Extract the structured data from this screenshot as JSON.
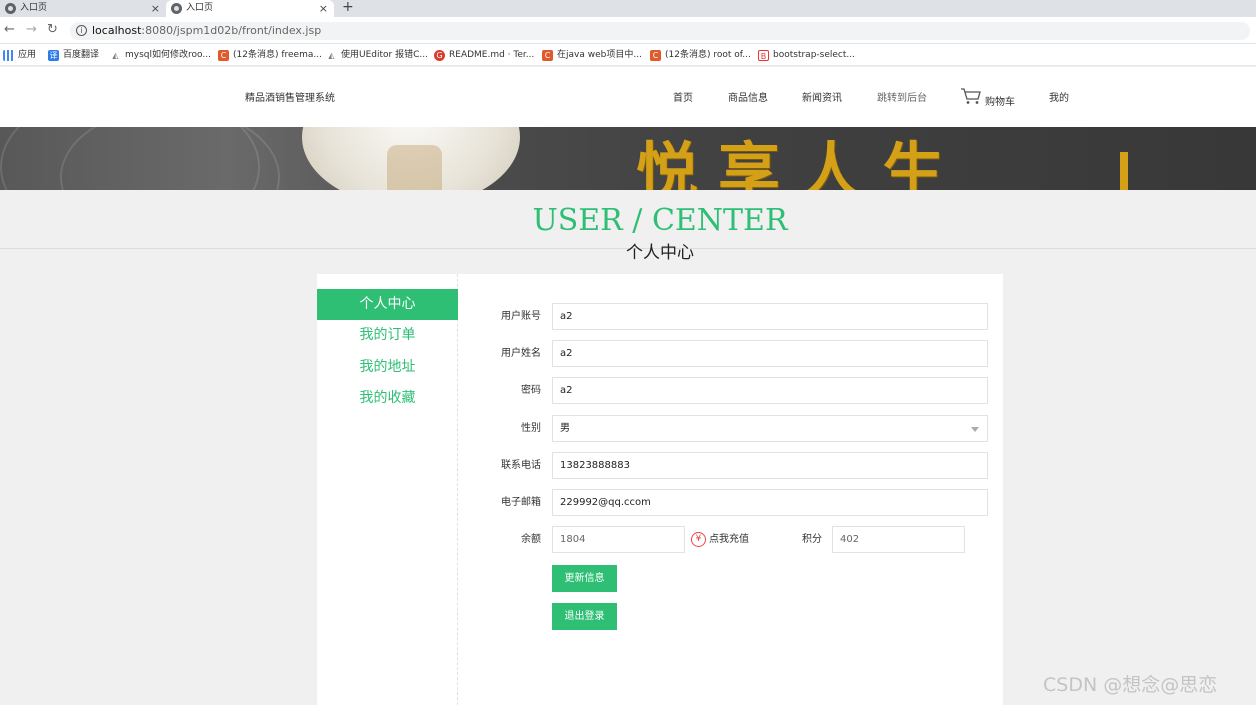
{
  "browser": {
    "tabs": [
      {
        "title": "入口页"
      },
      {
        "title": "入口页"
      }
    ],
    "new_tab": "+",
    "close_glyph": "×",
    "url_host": "localhost",
    "url_path": ":8080/jspm1d02b/front/index.jsp",
    "bookmarks": [
      {
        "label": "应用",
        "icon": "apps-grid-icon"
      },
      {
        "label": "百度翻译",
        "icon": "baidu-translate-icon"
      },
      {
        "label": "mysql如何修改roo...",
        "icon": "tool-icon"
      },
      {
        "label": "(12条消息) freema...",
        "icon": "csdn-icon"
      },
      {
        "label": "使用UEditor 报错C...",
        "icon": "tool-icon"
      },
      {
        "label": "README.md · Ter...",
        "icon": "gitee-icon"
      },
      {
        "label": "在java web项目中...",
        "icon": "csdn-icon"
      },
      {
        "label": "(12条消息) root of...",
        "icon": "csdn-icon"
      },
      {
        "label": "bootstrap-select...",
        "icon": "bootstrap-icon"
      }
    ]
  },
  "header": {
    "brand": "精品酒销售管理系统",
    "nav": {
      "home": "首页",
      "products": "商品信息",
      "news": "新闻资讯",
      "admin": "跳转到后台",
      "cart": "购物车",
      "mine": "我的"
    }
  },
  "banner": {
    "text": "悦享人生"
  },
  "title": {
    "en": "USER / CENTER",
    "cn": "个人中心"
  },
  "sidebar": {
    "items": [
      {
        "label": "个人中心",
        "active": true
      },
      {
        "label": "我的订单",
        "active": false
      },
      {
        "label": "我的地址",
        "active": false
      },
      {
        "label": "我的收藏",
        "active": false
      }
    ]
  },
  "form": {
    "account_label": "用户账号",
    "account_value": "a2",
    "name_label": "用户姓名",
    "name_value": "a2",
    "password_label": "密码",
    "password_value": "a2",
    "gender_label": "性别",
    "gender_value": "男",
    "phone_label": "联系电话",
    "phone_value": "13823888883",
    "email_label": "电子邮箱",
    "email_value": "229992@qq.ccom",
    "balance_label": "余额",
    "balance_value": "1804",
    "recharge_label": "点我充值",
    "points_label": "积分",
    "points_value": "402",
    "update_button": "更新信息",
    "logout_button": "退出登录"
  },
  "watermark": "CSDN @想念@思恋",
  "colors": {
    "accent": "#2ebf75",
    "recharge_icon": "#e44444",
    "banner_gold": "#d4a017"
  }
}
